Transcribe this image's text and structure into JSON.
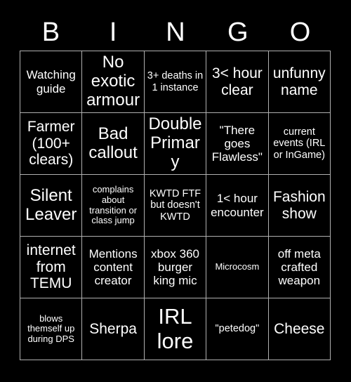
{
  "card": {
    "title": "BINGO",
    "background_color": "#000000",
    "text_color": "#ffffff",
    "border_color": "#b0b0b0",
    "columns": 5,
    "rows": 5
  },
  "header": {
    "letters": [
      {
        "label": "B"
      },
      {
        "label": "I"
      },
      {
        "label": "N"
      },
      {
        "label": "G"
      },
      {
        "label": "O"
      }
    ]
  },
  "grid": {
    "cells": [
      {
        "text": "Watching guide",
        "size": "m"
      },
      {
        "text": "No exotic armour",
        "size": "xl"
      },
      {
        "text": "3+ deaths in 1 instance",
        "size": "s"
      },
      {
        "text": "3< hour clear",
        "size": "l"
      },
      {
        "text": "unfunny name",
        "size": "l"
      },
      {
        "text": "Farmer (100+ clears)",
        "size": "l"
      },
      {
        "text": "Bad callout",
        "size": "xl"
      },
      {
        "text": "Double Primary",
        "size": "xl"
      },
      {
        "text": "\"There goes Flawless\"",
        "size": "m"
      },
      {
        "text": "current events (IRL or InGame)",
        "size": "s"
      },
      {
        "text": "Silent Leaver",
        "size": "xl"
      },
      {
        "text": "complains about transition or class jump",
        "size": "xs"
      },
      {
        "text": "KWTD FTF but doesn't KWTD",
        "size": "s"
      },
      {
        "text": "1< hour encounter",
        "size": "m"
      },
      {
        "text": "Fashion show",
        "size": "l"
      },
      {
        "text": "internet from TEMU",
        "size": "l"
      },
      {
        "text": "Mentions content creator",
        "size": "m"
      },
      {
        "text": "xbox 360 burger king mic",
        "size": "m"
      },
      {
        "text": "Microcosm",
        "size": "xs"
      },
      {
        "text": "off meta crafted weapon",
        "size": "m"
      },
      {
        "text": "blows themself up during DPS",
        "size": "xs"
      },
      {
        "text": "Sherpa",
        "size": "l"
      },
      {
        "text": "IRL lore",
        "size": "xxl"
      },
      {
        "text": "\"petedog\"",
        "size": "s"
      },
      {
        "text": "Cheese",
        "size": "l"
      }
    ]
  }
}
